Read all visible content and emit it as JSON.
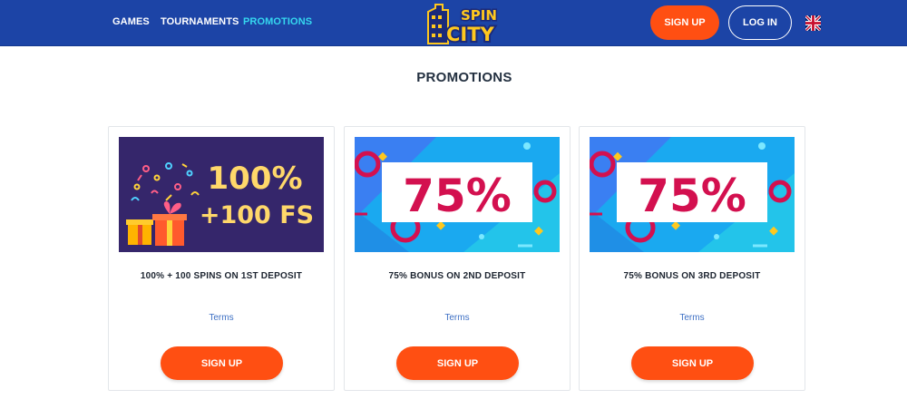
{
  "nav": {
    "games": "GAMES",
    "tournaments": "TOURNAMENTS",
    "promotions": "PROMOTIONS"
  },
  "logo": {
    "line1": "SPIN",
    "line2": "CITY"
  },
  "header_buttons": {
    "signup": "SIGN UP",
    "login": "LOG IN",
    "language_icon": "uk-flag-icon"
  },
  "page": {
    "title": "PROMOTIONS"
  },
  "promotions": [
    {
      "banner_line1": "100%",
      "banner_line2": "+100 FS",
      "title": "100% + 100 SPINS ON 1ST DEPOSIT",
      "terms": "Terms",
      "button": "SIGN UP"
    },
    {
      "banner_line1": "75%",
      "title": "75% BONUS ON 2ND DEPOSIT",
      "terms": "Terms",
      "button": "SIGN UP"
    },
    {
      "banner_line1": "75%",
      "title": "75% BONUS ON 3RD DEPOSIT",
      "terms": "Terms",
      "button": "SIGN UP"
    }
  ],
  "colors": {
    "header_bg": "#1c44a6",
    "accent_orange": "#ff4f12",
    "nav_active": "#35d7ef",
    "logo_yellow": "#ffc81e",
    "banner1_bg": "#35266b",
    "banner_pct_red": "#d3104f",
    "banner_blue": "#1aa9f0"
  }
}
